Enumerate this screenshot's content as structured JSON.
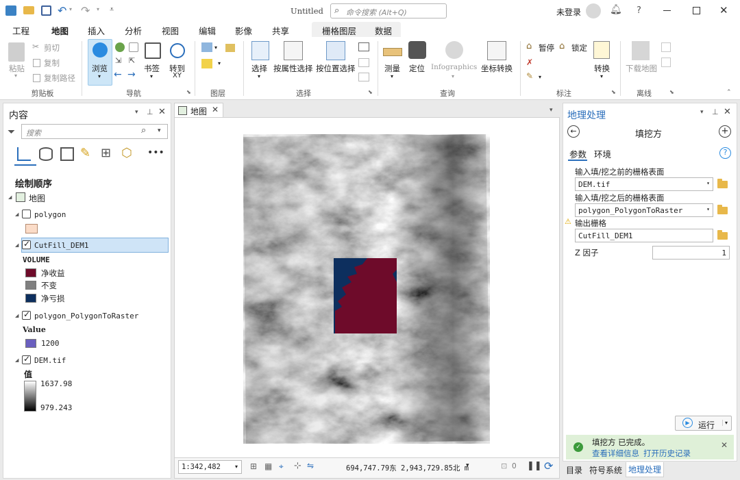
{
  "titlebar": {
    "doc_title": "Untitled",
    "search_placeholder": "命令搜索 (Alt+Q)",
    "signin": "未登录",
    "help": "?"
  },
  "ribbon_tabs": [
    "工程",
    "地图",
    "插入",
    "分析",
    "视图",
    "编辑",
    "影像",
    "共享"
  ],
  "context_tabs": [
    "栅格图层",
    "数据"
  ],
  "clipboard": {
    "paste": "粘贴",
    "cut": "剪切",
    "copy": "复制",
    "copy_path": "复制路径",
    "label": "剪贴板"
  },
  "navigate": {
    "explore": "浏览",
    "bookmarks": "书签",
    "goto_xy": "转到",
    "goto_xy2": "XY",
    "label": "导航"
  },
  "layer": {
    "label": "图层"
  },
  "selection": {
    "select": "选择",
    "by_attr": "按属性选择",
    "by_loc": "按位置选择",
    "label": "选择"
  },
  "inquiry": {
    "measure": "测量",
    "locate": "定位",
    "infographics": "Infographics",
    "coord": "坐标转换",
    "label": "查询"
  },
  "labeling": {
    "pause": "暂停",
    "lock": "锁定",
    "convert": "转换",
    "label": "标注"
  },
  "offline": {
    "download": "下载地图",
    "label": "离线"
  },
  "contents": {
    "title": "内容",
    "search_placeholder": "搜索",
    "draw_order": "绘制顺序",
    "map_name": "地图",
    "layers": [
      {
        "name": "polygon",
        "checked": false
      },
      {
        "name": "CutFill_DEM1",
        "checked": true,
        "field": "VOLUME",
        "classes": [
          {
            "label": "净收益",
            "color": "#6e0b2a"
          },
          {
            "label": "不变",
            "color": "#808080"
          },
          {
            "label": "净亏损",
            "color": "#0d2f5e"
          }
        ]
      },
      {
        "name": "polygon_PolygonToRaster",
        "checked": true,
        "field": "Value",
        "classes": [
          {
            "label": "1200",
            "color": "#6a5fbf"
          }
        ]
      },
      {
        "name": "DEM.tif",
        "checked": true,
        "field": "值",
        "high": "1637.98",
        "low": "979.243"
      }
    ]
  },
  "map_view": {
    "tab_label": "地图",
    "scale": "1:342,482",
    "coords": "694,747.79东 2,943,729.85北 m",
    "selection_count": "0"
  },
  "geoprocessing": {
    "title": "地理处理",
    "tool_name": "填挖方",
    "tab_params": "参数",
    "tab_env": "环境",
    "param1_label": "输入填/挖之前的栅格表面",
    "param1_value": "DEM.tif",
    "param2_label": "输入填/挖之后的栅格表面",
    "param2_value": "polygon_PolygonToRaster",
    "param3_label": "输出栅格",
    "param3_value": "CutFill_DEM1",
    "param4_label": "Z 因子",
    "param4_value": "1",
    "run": "运行",
    "status": "填挖方 已完成。",
    "view_details": "查看详细信息",
    "open_history": "打开历史记录"
  },
  "bottom_tabs": [
    "目录",
    "符号系统",
    "地理处理"
  ]
}
